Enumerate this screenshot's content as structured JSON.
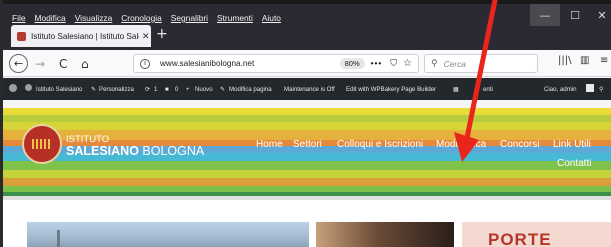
{
  "menu": {
    "items": [
      "File",
      "Modifica",
      "Visualizza",
      "Cronologia",
      "Segnalibri",
      "Strumenti",
      "Aiuto"
    ]
  },
  "window_controls": {
    "minimize": "—",
    "maximize": "☐",
    "close": "✕"
  },
  "tab": {
    "title": "Istituto Salesiano | Istituto Sale",
    "close": "✕",
    "new_tab": "+"
  },
  "navbar": {
    "back": "←",
    "forward": "→",
    "reload": "C",
    "home": "⌂",
    "url": "www.salesianibologna.net",
    "zoom": "80%",
    "more": "•••",
    "search_placeholder": "Cerca",
    "library": "|||\\",
    "sidebar": "▥",
    "menu": "≡"
  },
  "adminbar": {
    "items": [
      "Istituto Salesiano",
      "Personalizza",
      "1",
      "0",
      "Nuovo",
      "Modifica pagina",
      "Maintenance is Off",
      "Edit with WPBakery Page Builder",
      "enti"
    ],
    "greeting": "Ciao, admin"
  },
  "site": {
    "logo_line1": "ISTITUTO",
    "logo_line2_bold": "SALESIANO",
    "logo_line2_rest": "BOLOGNA",
    "nav": [
      "Home",
      "Settori",
      "Colloqui e Iscrizioni",
      "Modulistica",
      "Concorsi",
      "Link Utili",
      "Contatti"
    ],
    "stripe_colors": [
      "#e6d02a",
      "#b9cd3c",
      "#49b9d6",
      "#7cc24a",
      "#cfd336",
      "#e8a83a",
      "#6aa9dc",
      "#3a8f4a"
    ],
    "brand_red": "#b63025"
  },
  "preview": {
    "banner_text": "PORTE"
  },
  "annotation": {
    "arrow_color": "#e8261c"
  }
}
